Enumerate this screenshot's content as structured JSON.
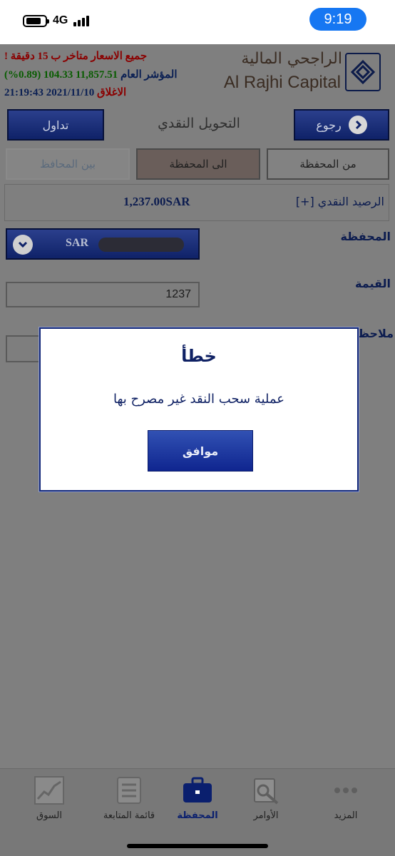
{
  "status_bar": {
    "network": "4G",
    "time": "9:19"
  },
  "header": {
    "brand_ar": "الراجحي المالية",
    "brand_en": "Al Rajhi Capital",
    "delay_notice": "جميع الاسعار متاخر ب 15 دقيقة !",
    "index_label": "المؤشر العام",
    "index_value": "11,857.51",
    "index_change": "104.33",
    "index_change_pct": "(0.89%)",
    "close_label": "الاغلاق",
    "close_datetime": "2021/11/10 21:19:43"
  },
  "toolbar": {
    "back_label": "رجوع",
    "title": "التحويل النقدي",
    "trade_label": "تداول"
  },
  "transfer_tabs": [
    {
      "label": "من المحفظة",
      "state": "normal"
    },
    {
      "label": "الى المحفظة",
      "state": "selected"
    },
    {
      "label": "بين المحافظ",
      "state": "disabled"
    }
  ],
  "form": {
    "cash_balance_label": "الرصيد النقدي [+]",
    "cash_balance_value": "1,237.00SAR",
    "portfolio_label": "المحفظة",
    "portfolio_value": "SAR",
    "amount_label": "القيمة",
    "amount_value": "1237",
    "notes_label": "ملاحظات"
  },
  "dialog": {
    "title": "خطأ",
    "message": "عملية سحب النقد غير مصرح بها",
    "ok_label": "موافق"
  },
  "tab_bar": {
    "active": "المحفظة",
    "items": [
      {
        "label": "المزيد",
        "icon": "more-icon"
      },
      {
        "label": "الأوامر",
        "icon": "orders-icon"
      },
      {
        "label": "المحفظة",
        "icon": "briefcase-icon"
      },
      {
        "label": "قائمة المتابعة",
        "icon": "watchlist-icon"
      },
      {
        "label": "السوق",
        "icon": "market-chart-icon"
      }
    ]
  },
  "colors": {
    "navy": "#0f2268",
    "dialog_button": "#1a34a0",
    "status_time_pill": "#1677f2",
    "overlay_gray": "#7f7f7f",
    "notice_red": "#8a0000",
    "change_green": "#085c00"
  }
}
